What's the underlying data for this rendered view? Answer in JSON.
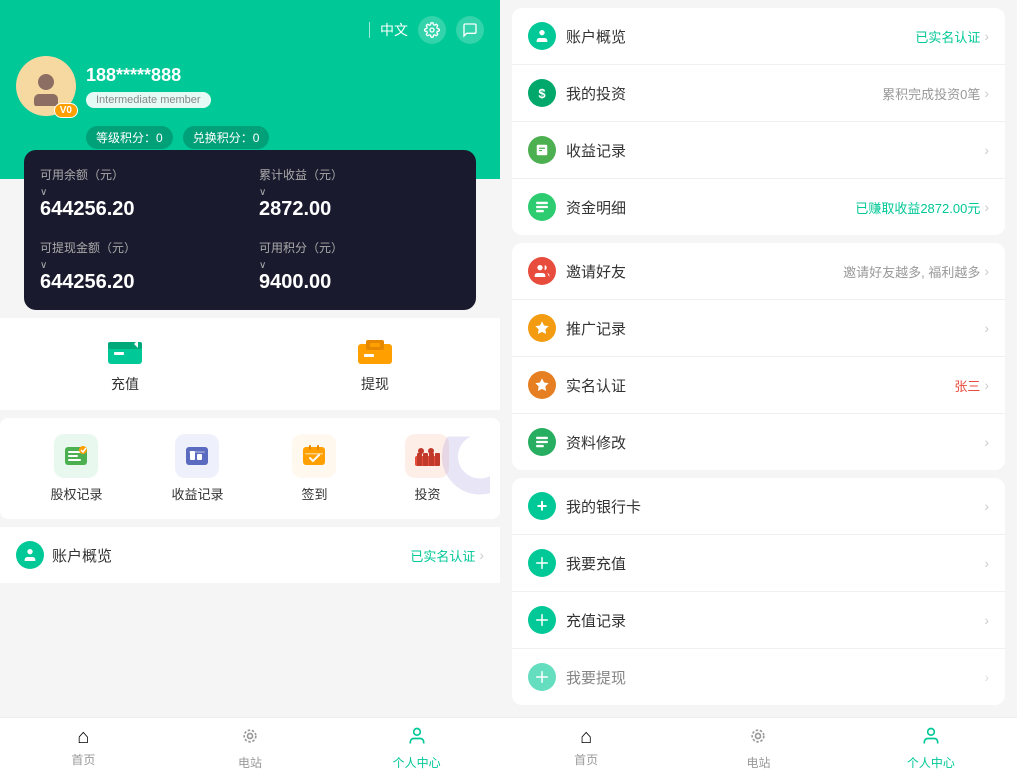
{
  "left": {
    "lang": "中文",
    "username": "188*****888",
    "member_badge": "Intermediate member",
    "avatar_badge": "V0",
    "points": {
      "level": "等级积分：0",
      "exchange": "兑换积分：0"
    },
    "balance": {
      "available_label": "可用余额（元）",
      "cumulative_label": "累计收益（元）",
      "withdrawable_label": "可提现金额（元）",
      "points_label": "可用积分（元）",
      "available_value": "644256.20",
      "cumulative_value": "2872.00",
      "withdrawable_value": "644256.20",
      "points_value": "9400.00"
    },
    "actions": {
      "recharge": "充值",
      "withdraw": "提现"
    },
    "quick_nav": [
      {
        "label": "股权记录",
        "color": "#4caf50"
      },
      {
        "label": "收益记录",
        "color": "#5b6bbf"
      },
      {
        "label": "签到",
        "color": "#ff9f00"
      },
      {
        "label": "投资",
        "color": "#e74c3c"
      }
    ],
    "account_overview": {
      "label": "账户概览",
      "status": "已实名认证"
    },
    "bottom_nav": [
      {
        "label": "首页",
        "icon": "⌂"
      },
      {
        "label": "电站",
        "icon": "⊙"
      },
      {
        "label": "个人中心",
        "icon": "👤",
        "active": true
      }
    ]
  },
  "right": {
    "menu_groups": [
      {
        "items": [
          {
            "label": "账户概览",
            "right": "已实名认证",
            "right_class": "green",
            "icon_bg": "#00c896",
            "icon_color": "#fff",
            "icon": "👤"
          },
          {
            "label": "我的投资",
            "right": "累积完成投资0笔",
            "right_class": "normal",
            "icon_bg": "#00a86b",
            "icon_color": "#fff",
            "icon": "$"
          },
          {
            "label": "收益记录",
            "right": "",
            "right_class": "normal",
            "icon_bg": "#4caf50",
            "icon_color": "#fff",
            "icon": "📋"
          },
          {
            "label": "资金明细",
            "right": "已赚取收益2872.00元",
            "right_class": "green",
            "icon_bg": "#2ecc71",
            "icon_color": "#fff",
            "icon": "📄"
          }
        ]
      },
      {
        "items": [
          {
            "label": "邀请好友",
            "right": "邀请好友越多, 福利越多",
            "right_class": "normal",
            "icon_bg": "#e74c3c",
            "icon_color": "#fff",
            "icon": "👥"
          },
          {
            "label": "推广记录",
            "right": "",
            "right_class": "normal",
            "icon_bg": "#f39c12",
            "icon_color": "#fff",
            "icon": "👑"
          },
          {
            "label": "实名认证",
            "right": "张三",
            "right_class": "red",
            "icon_bg": "#e67e22",
            "icon_color": "#fff",
            "icon": "⭐"
          },
          {
            "label": "资料修改",
            "right": "",
            "right_class": "normal",
            "icon_bg": "#27ae60",
            "icon_color": "#fff",
            "icon": "📋"
          }
        ]
      },
      {
        "items": [
          {
            "label": "我的银行卡",
            "right": "",
            "right_class": "normal",
            "icon_bg": "#00c896",
            "icon_color": "#fff",
            "icon": "+"
          },
          {
            "label": "我要充值",
            "right": "",
            "right_class": "normal",
            "icon_bg": "#00c896",
            "icon_color": "#fff",
            "icon": "↻"
          },
          {
            "label": "充值记录",
            "right": "",
            "right_class": "normal",
            "icon_bg": "#00c896",
            "icon_color": "#fff",
            "icon": "↻"
          },
          {
            "label": "我要提现",
            "right": "",
            "right_class": "normal",
            "icon_bg": "#00c896",
            "icon_color": "#fff",
            "icon": "↻"
          }
        ]
      }
    ],
    "bottom_nav": [
      {
        "label": "首页",
        "icon": "⌂"
      },
      {
        "label": "电站",
        "icon": "⊙"
      },
      {
        "label": "个人中心",
        "icon": "👤",
        "active": true
      }
    ]
  }
}
